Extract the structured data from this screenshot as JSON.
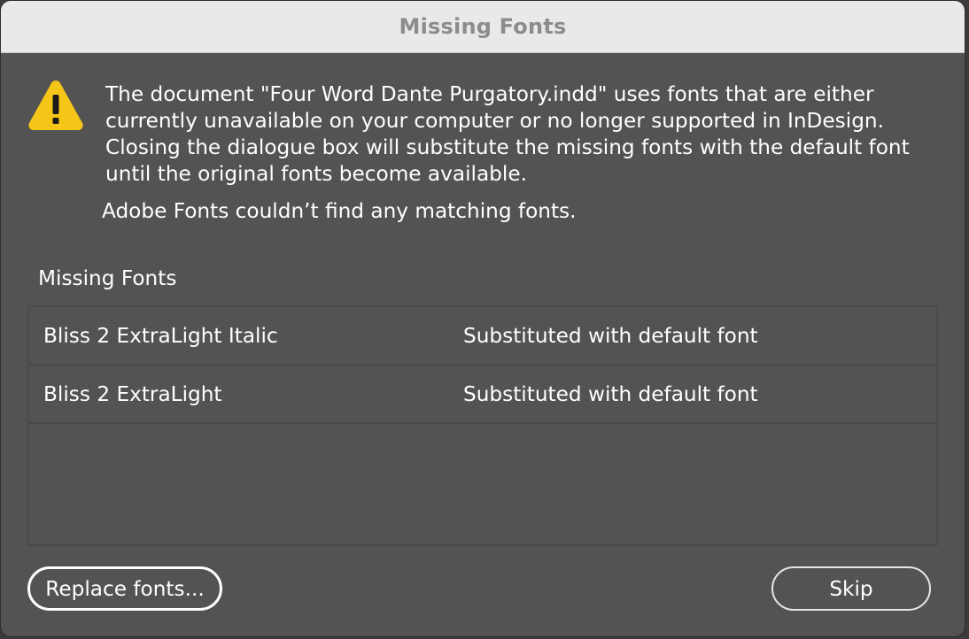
{
  "window": {
    "title": "Missing Fonts"
  },
  "icons": {
    "warning": "warning-triangle-icon",
    "warning_color": "#f5c518"
  },
  "message": {
    "line1": "The document \"Four Word Dante Purgatory.indd\" uses fonts that are either",
    "line2": "currently unavailable on your computer or no longer supported in InDesign.",
    "line3": "Closing the dialogue box will substitute the missing fonts with the default font",
    "line4": "until the original fonts become available.",
    "adobe_fonts": "Adobe Fonts couldn’t find any matching fonts."
  },
  "missing_fonts": {
    "label": "Missing Fonts",
    "rows": [
      {
        "name": "Bliss 2 ExtraLight Italic",
        "status": "Substituted with default font"
      },
      {
        "name": "Bliss 2 ExtraLight",
        "status": "Substituted with default font"
      }
    ]
  },
  "buttons": {
    "replace_fonts": "Replace fonts...",
    "skip": "Skip"
  },
  "colors": {
    "dialog_bg": "#535353",
    "titlebar_bg": "#e9e9e9",
    "title_text": "#8c8c8c",
    "text": "#ffffff"
  }
}
